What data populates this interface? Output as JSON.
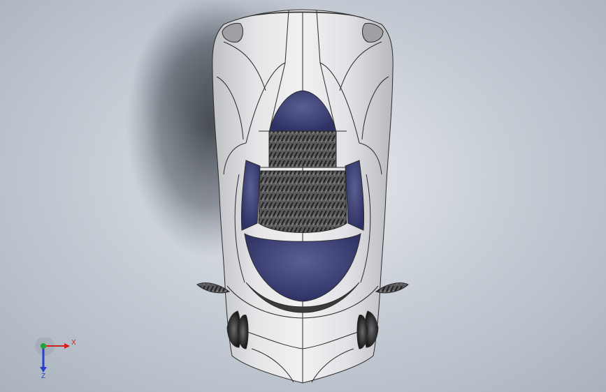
{
  "viewport": {
    "background_top": "#e8ebef",
    "background_bottom": "#a9b2be"
  },
  "model": {
    "body_color": "#d9d9dc",
    "edge_color": "#2b2b2b",
    "glass_color": "#44487a",
    "carbon_color": "#3a3a3a"
  },
  "triad": {
    "x_label": "X",
    "z_label": "Z",
    "x_color": "#d21f1f",
    "y_color": "#1fa53a",
    "z_color": "#2a3fd0"
  }
}
